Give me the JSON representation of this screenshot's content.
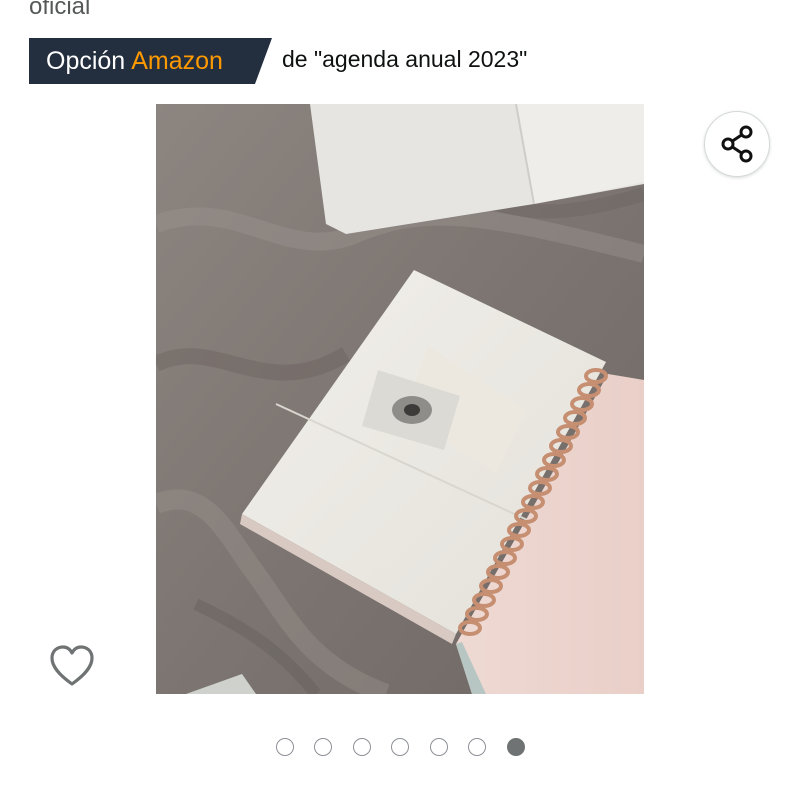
{
  "header": {
    "top_text": "oficial",
    "badge": {
      "part1": "Opción",
      "part2": "Amazon",
      "suffix": "de \"agenda anual 2023\"",
      "background_color": "#232f3e",
      "accent_color": "#ff9900"
    }
  },
  "gallery": {
    "image_description_icon": "product-photo",
    "share_icon": "share-icon",
    "wishlist_icon": "heart-outline-icon",
    "total_images": 7,
    "active_index": 6
  }
}
